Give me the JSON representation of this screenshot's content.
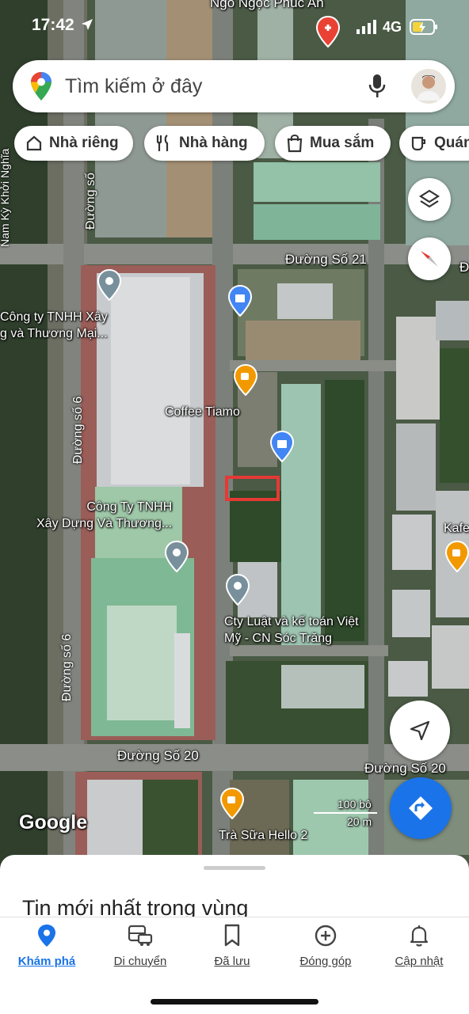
{
  "status_bar": {
    "time": "17:42",
    "network": "4G"
  },
  "search": {
    "placeholder": "Tìm kiếm ở đây"
  },
  "chips": [
    {
      "label": "Nhà riêng",
      "icon": "home-icon"
    },
    {
      "label": "Nhà hàng",
      "icon": "restaurant-icon"
    },
    {
      "label": "Mua sắm",
      "icon": "shopping-bag-icon"
    },
    {
      "label": "Quán",
      "icon": "coffee-icon"
    }
  ],
  "map": {
    "top_partial_label": "Ngõ Ngọc Phúc An",
    "roads": {
      "duong_so_21": "Đường Số 21",
      "duong_so_20": "Đường Số 20",
      "duong_so_20_right": "Đường Số 20",
      "duong_so_6_top": "Đường số 6",
      "duong_so_6_bottom": "Đường số 6",
      "duong_so_left_top": "Đường số",
      "right_edge_d": "Đ",
      "left_edge_vertical": "Nam Kỳ Khởi Nghĩa"
    },
    "pois": {
      "cong_ty_1_line1": "Công ty TNHH Xây",
      "cong_ty_1_line2": "g và Thương Mại...",
      "coffee_tiamo": "Coffee Tiamo",
      "cong_ty_2_line1": "Công Ty TNHH",
      "cong_ty_2_line2": "Xây Dựng Và Thương...",
      "cty_luat_line1": "Cty Luật và kế toán Việt",
      "cty_luat_line2": "Mỹ - CN Sóc Trăng",
      "kafe": "Kafe",
      "tra_sua": "Trà Sữa Hello 2"
    },
    "scale": {
      "feet": "100 bộ",
      "meters": "20 m"
    },
    "logo": "Google"
  },
  "bottom_sheet": {
    "title": "Tin mới nhất trong vùng"
  },
  "nav": [
    {
      "label": "Khám phá",
      "icon": "location-pin-icon",
      "active": true
    },
    {
      "label": "Di chuyển",
      "icon": "commute-icon",
      "active": false
    },
    {
      "label": "Đã lưu",
      "icon": "bookmark-icon",
      "active": false
    },
    {
      "label": "Đóng góp",
      "icon": "add-circle-icon",
      "active": false
    },
    {
      "label": "Cập nhật",
      "icon": "bell-icon",
      "active": false
    }
  ],
  "colors": {
    "accent": "#1a73e8",
    "marker_blue": "#4285f4",
    "marker_orange": "#f29900",
    "marker_gray": "#78909c",
    "highlight_red": "#e53935"
  }
}
